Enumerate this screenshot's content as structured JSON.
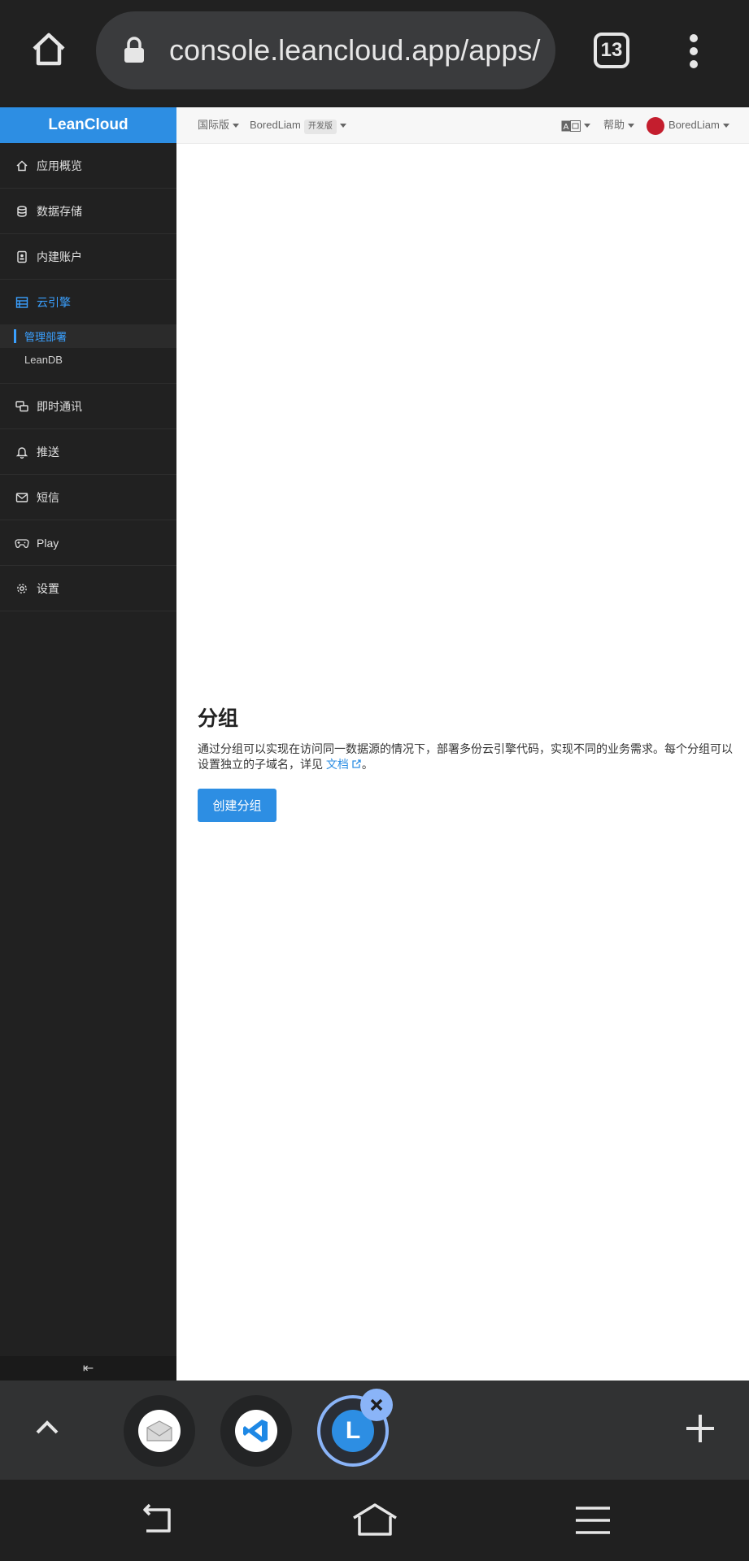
{
  "browser": {
    "url": "console.leancloud.app/apps/",
    "tab_count": "13"
  },
  "sidebar": {
    "brand": "LeanCloud",
    "items": [
      {
        "label": "应用概览",
        "icon": "home-icon"
      },
      {
        "label": "数据存储",
        "icon": "database-icon"
      },
      {
        "label": "内建账户",
        "icon": "contact-card-icon"
      },
      {
        "label": "云引擎",
        "icon": "server-icon"
      },
      {
        "label": "即时通讯",
        "icon": "chat-icon"
      },
      {
        "label": "推送",
        "icon": "bell-icon"
      },
      {
        "label": "短信",
        "icon": "mail-icon"
      },
      {
        "label": "Play",
        "icon": "gamepad-icon"
      },
      {
        "label": "设置",
        "icon": "gear-icon"
      }
    ],
    "sub_items": [
      {
        "label": "管理部署",
        "active": true
      },
      {
        "label": "LeanDB",
        "active": false
      }
    ],
    "collapse_glyph": "⇤"
  },
  "topbar": {
    "region": "国际版",
    "app_name": "BoredLiam",
    "env_badge": "开发版",
    "help": "帮助",
    "user": "BoredLiam"
  },
  "content": {
    "title": "分组",
    "description": "通过分组可以实现在访问同一数据源的情况下，部署多份云引擎代码，实现不同的业务需求。每个分组可以设置独立的子域名，详见",
    "doc_link": "文档",
    "period": "。",
    "create_button": "创建分组"
  },
  "switcher": {
    "current_tab_letter": "L"
  },
  "colors": {
    "accent": "#2d8ee3",
    "sidebar_bg": "#212121",
    "active_text": "#3aa0ff"
  }
}
